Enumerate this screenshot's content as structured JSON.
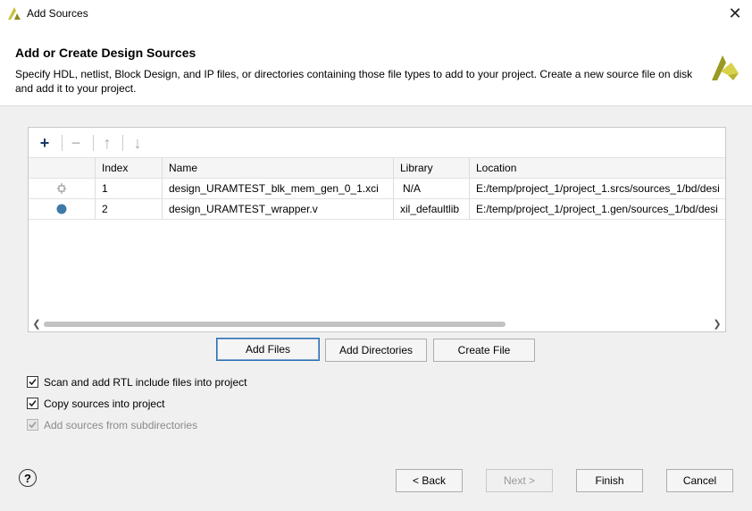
{
  "window": {
    "title": "Add Sources",
    "close_glyph": "✕"
  },
  "header": {
    "title": "Add or Create Design Sources",
    "description": "Specify HDL, netlist, Block Design, and IP files, or directories containing those file types to add to your project. Create a new source file on disk and add it to your project."
  },
  "toolbar": {
    "add": "+",
    "remove": "−",
    "up": "↑",
    "down": "↓"
  },
  "table": {
    "columns": [
      "",
      "Index",
      "Name",
      "Library",
      "Location"
    ],
    "rows": [
      {
        "icon": "ip-core-icon",
        "index": "1",
        "name": "design_URAMTEST_blk_mem_gen_0_1.xci",
        "library": "N/A",
        "location": "E:/temp/project_1/project_1.srcs/sources_1/bd/desi"
      },
      {
        "icon": "hdl-file-icon",
        "index": "2",
        "name": "design_URAMTEST_wrapper.v",
        "library": "xil_defaultlib",
        "location": "E:/temp/project_1/project_1.gen/sources_1/bd/desi"
      }
    ]
  },
  "buttons": {
    "add_files": "Add Files",
    "add_directories": "Add Directories",
    "create_file": "Create File",
    "back": "< Back",
    "next": "Next >",
    "finish": "Finish",
    "cancel": "Cancel"
  },
  "options": [
    {
      "label": "Scan and add RTL include files into project",
      "checked": true,
      "enabled": true
    },
    {
      "label": "Copy sources into project",
      "checked": true,
      "enabled": true
    },
    {
      "label": "Add sources from subdirectories",
      "checked": true,
      "enabled": false
    }
  ],
  "help": {
    "glyph": "?"
  },
  "colors": {
    "accent": "#2a6fb5",
    "logo_yellow": "#c9c23a",
    "logo_olive": "#8a8a1e",
    "hdl_dot": "#3d7aa8"
  }
}
